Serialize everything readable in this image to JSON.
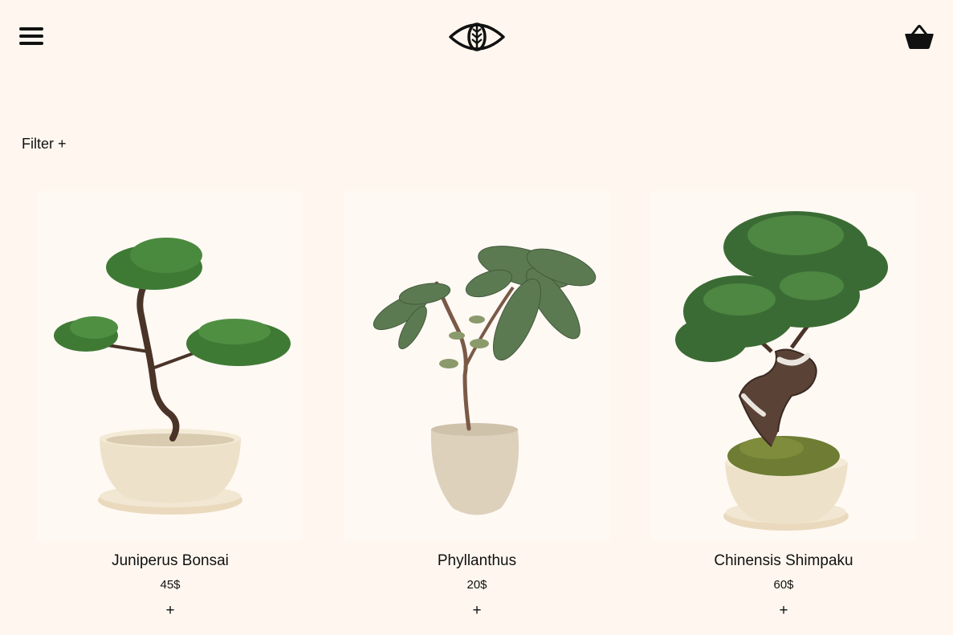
{
  "header": {
    "menu_icon": "hamburger-menu-icon",
    "logo_icon": "eye-leaf-logo",
    "cart_icon": "basket-icon"
  },
  "filter": {
    "label": "Filter +"
  },
  "products": [
    {
      "name": "Juniperus Bonsai",
      "price": "45$",
      "add_label": "+"
    },
    {
      "name": "Phyllanthus",
      "price": "20$",
      "add_label": "+"
    },
    {
      "name": "Chinensis Shimpaku",
      "price": "60$",
      "add_label": "+"
    }
  ],
  "colors": {
    "background": "#fff7ef",
    "text": "#111111",
    "foliage": "#3f7a35",
    "pot": "#ece2cc"
  }
}
